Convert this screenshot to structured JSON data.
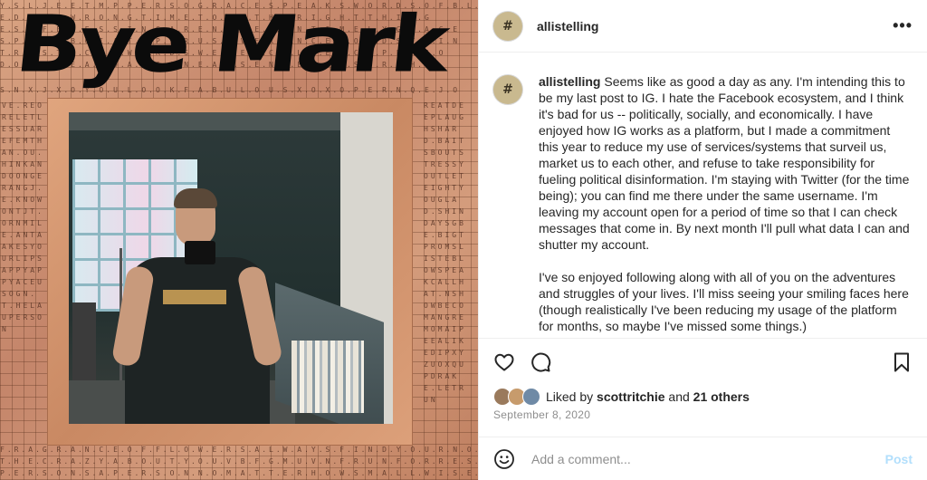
{
  "image": {
    "handwritten_title": "Bye Mark",
    "tile_rows": [
      "Y.S.L.J.E.E.T.M.P.P.E.R.S.O.G.R.A.C.E.S.P.E.A.K.S.W.O.R.D.S.O.F.B.L.E.S.S",
      "E.D.T.H.E.W.R.O.N.G.T.I.M.E.T.O.D.O.T.H.E.R.I.G.H.T.T.H.I.N.G",
      "E.S.O.F.B.L.E.S.S.I.N.G.A.R.E.N.E.V.E.R.U.N.T.I.M.E.L.Y.G.R.A.C.E",
      "S.P.E.C.T.B.O.I.A.T.F.P.L.R.U.S.H.V.E.R.E.N.C.E.W.O.R.D.S.T.H.I.N",
      "T.R.U.S.T.S.C.U.T.W.O.R.D.S.W.E.R.E.N.C.E.L.L.E.N.C.E.P.E.R.I.O",
      "D.O.V.E.Y.E.A.H.D.A.T.S.O.N.E.A.S.S.E.N.T.E.N.C.E.S.O.R.O.H.Y",
      "S.N.X.J.X.O.Y.O.U.L.O.O.K.F.A.B.U.L.O.U.S.X.O.X.O.P.E.R.N.Q.E.J.O"
    ],
    "bottom_rows": [
      "F.R.A.G.R.A.N.C.E.O.F.F.L.O.W.E.R.S.A.L.W.A.Y.S.F.I.N.D.Y.O.U.R.N.O.S.E",
      "T.H.E.C.R.A.Z.Y.A.B.O.U.T.Y.O.U.V.B.F.G.M.U.V.N.F.R.U.N.F.O.R.R.E.S.T.R.U.N",
      "P.E.R.S.O.N.S.A.P.E.R.S.O.N.N.O.M.A.T.T.E.R.H.O.W.S.M.A.L.L.W.I.S.E.R"
    ],
    "left_column": "VE.REORELETLESSUAREFEMTHAN.OU.HINKANDOONGERANGJ.E.KNOWONTJT.ORNMILE.ANTAAKESYOURLIPSAPPYAPPYACEUSOGN.T.HELAUPERSON",
    "right_column": "REATDEEPLAUGHSHARD.BAITSBOUTSTRESSYOUTLETEIGHTYOUGLAD.SHINDAYSGBE.BIGTPROMSLISTEBLOWSPEAKCALLHAT.NSHOWBECOMANGREMOMAIPEEALIKEDIPXYZUOXQUPDRAKE.LETRUN"
  },
  "header": {
    "avatar_glyph": "#",
    "username": "allistelling",
    "more_label": "•••"
  },
  "caption": {
    "username": "allistelling",
    "paragraphs": [
      "Seems like as good a day as any. I'm intending this to be my last post to IG. I hate the Facebook ecosystem, and I think it's bad for us -- politically, socially, and economically. I have enjoyed how IG works as a platform, but I made a commitment this year to reduce my use of services/systems that surveil us, market us to each other, and refuse to take responsibility for fueling political disinformation. I'm staying with Twitter (for the time being); you can find me there under the same username. I'm leaving my account open for a period of time so that I can check messages that come in. By next month I'll pull what data I can and shutter my account.",
      "I've so enjoyed following along with all of you on the adventures and struggles of your lives. I'll miss seeing your smiling faces here (though realistically I've been reducing my usage of the platform for months, so maybe I've missed some things.)"
    ]
  },
  "actions": {
    "like_icon": "heart-icon",
    "comment_icon": "comment-bubble-icon",
    "save_icon": "bookmark-icon"
  },
  "likes": {
    "prefix": "Liked by",
    "first_liker": "scottritchie",
    "conjunction": "and",
    "others": "21 others"
  },
  "date": "September 8, 2020",
  "comment": {
    "placeholder": "Add a comment...",
    "post_label": "Post",
    "post_color": "#b2dffc"
  }
}
